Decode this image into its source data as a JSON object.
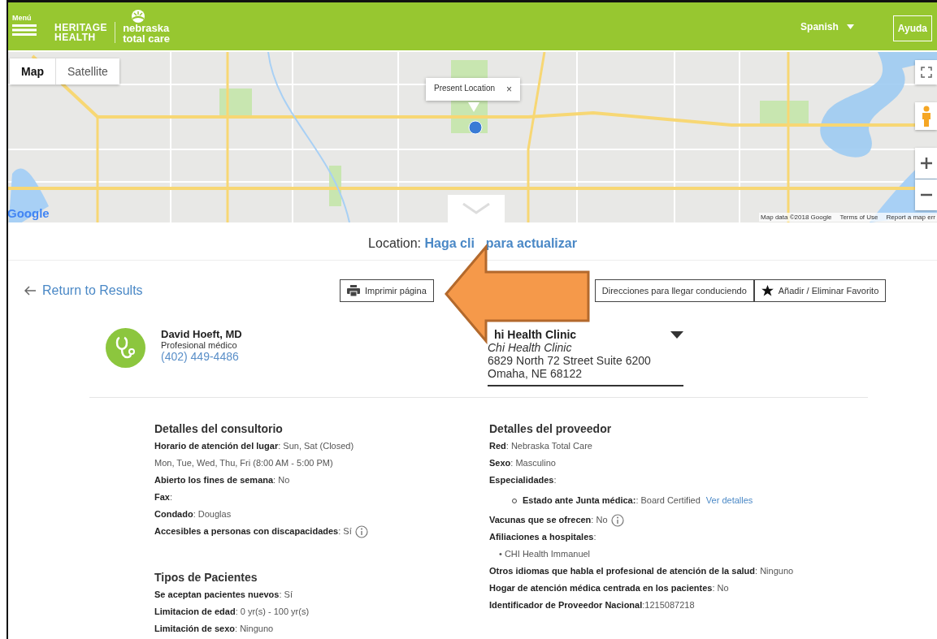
{
  "header": {
    "menu_label": "Menú",
    "heritage_logo": [
      "HERITAGE",
      "HEALTH"
    ],
    "nebraska_logo": [
      "nebraska",
      "total care"
    ],
    "language": "Spanish",
    "help": "Ayuda"
  },
  "map": {
    "tabs": [
      {
        "label": "Map",
        "selected": true
      },
      {
        "label": "Satellite",
        "selected": false
      }
    ],
    "popup": {
      "title": "Present Location",
      "close": "×"
    },
    "logo": "Google",
    "attribution": [
      "Map data ©2018 Google",
      "Terms of Use",
      "Report a map err"
    ]
  },
  "location": {
    "label": "Location:",
    "link_parts": [
      "Haga cli",
      "para actualizar"
    ]
  },
  "return_link": "Return to Results",
  "actions": [
    {
      "kind": "print",
      "label": "Imprimir página"
    },
    {
      "kind": "directions",
      "label": "Direcciones para llegar conduciendo"
    },
    {
      "kind": "favorite",
      "label": "Añadir / Eliminar Favorito"
    }
  ],
  "provider": {
    "name": "David Hoeft, MD",
    "role": "Profesional médico",
    "phone": "(402) 449-4486"
  },
  "location_select": {
    "name": "hi Health Clinic",
    "subtitle": "Chi Health Clinic",
    "address": [
      "6829 North 72 Street Suite 6200",
      "Omaha, NE 68122"
    ]
  },
  "sections": [
    {
      "title": "Detalles del consultorio",
      "rows": [
        {
          "kind": "row",
          "text": "**Horario de atención del lugar**: Sun, Sat (Closed)",
          "info": false
        },
        {
          "kind": "row",
          "text": "Mon, Tue, Wed, Thu, Fri (8:00 AM - 5:00 PM)",
          "info": false
        },
        {
          "kind": "row",
          "text": "**Abierto los fines de semana**: No",
          "info": false
        },
        {
          "kind": "row",
          "text": "**Fax**:",
          "info": false
        },
        {
          "kind": "row",
          "text": "**Condado**: Douglas",
          "info": false
        },
        {
          "kind": "row",
          "text": "**Accesibles a personas con discapacidades**: Sí",
          "info": true
        }
      ]
    },
    {
      "title": "Tipos de Pacientes",
      "rows": [
        {
          "kind": "row",
          "text": "**Se aceptan pacientes nuevos**: Sí",
          "info": false
        },
        {
          "kind": "row",
          "text": "**Limitacion de edad**: 0 yr(s) - 100 yr(s)",
          "info": false
        },
        {
          "kind": "row",
          "text": "**Limitación de sexo**: Ninguno",
          "info": false
        }
      ]
    },
    {
      "title": "Detalles del proveedor",
      "rows": [
        {
          "kind": "row",
          "text": "**Red**: Nebraska Total Care",
          "info": false
        },
        {
          "kind": "row",
          "text": "**Sexo**: Masculino",
          "info": false
        },
        {
          "kind": "row",
          "text": "**Especialidades**:",
          "info": false
        },
        {
          "kind": "sub",
          "text": "**Estado ante Junta médica:**: Board Certified",
          "link": "Ver detalles"
        },
        {
          "kind": "row",
          "text": "**Vacunas que se ofrecen**: No",
          "info": true
        },
        {
          "kind": "row",
          "text": "**Afiliaciones a hospitales**:",
          "info": false
        },
        {
          "kind": "bullet",
          "text": "• CHI Health Immanuel"
        },
        {
          "kind": "row",
          "text": "**Otros idiomas que habla el profesional de atención de la salud**: Ninguno",
          "info": false
        },
        {
          "kind": "row",
          "text": "**Hogar de atención médica centrada en los pacientes**: No",
          "info": false
        },
        {
          "kind": "row",
          "text": "**Identificador de Proveedor Nacional**:1215087218",
          "info": false
        }
      ]
    }
  ]
}
